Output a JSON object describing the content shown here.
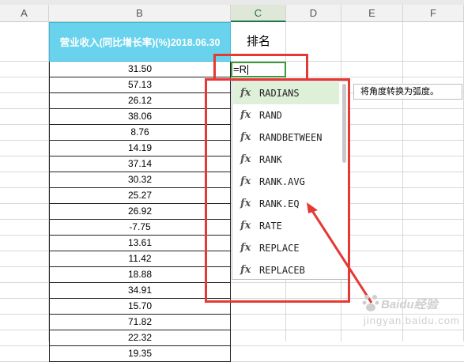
{
  "columns": [
    "A",
    "B",
    "C",
    "D",
    "E",
    "F"
  ],
  "active_column": "C",
  "header_b": "营业收入(同比增长率)(%)2018.06.30",
  "header_c": "排名",
  "formula_input": "=R",
  "values": [
    "31.50",
    "57.13",
    "26.12",
    "38.06",
    "8.76",
    "14.19",
    "37.14",
    "30.32",
    "25.27",
    "26.92",
    "-7.75",
    "13.61",
    "11.42",
    "18.88",
    "34.91",
    "15.70",
    "71.82",
    "22.32",
    "19.35"
  ],
  "autocomplete": {
    "items": [
      "RADIANS",
      "RAND",
      "RANDBETWEEN",
      "RANK",
      "RANK.AVG",
      "RANK.EQ",
      "RATE",
      "REPLACE",
      "REPLACEB"
    ],
    "selected_index": 0,
    "fx_symbol": "fx",
    "tooltip": "将角度转换为弧度。"
  },
  "watermark": {
    "brand": "Baidu经验",
    "url": "jingyan.baidu.com"
  },
  "colors": {
    "header_fill": "#69d3ed",
    "accent_green": "#217346",
    "annotation_red": "#e53935"
  }
}
